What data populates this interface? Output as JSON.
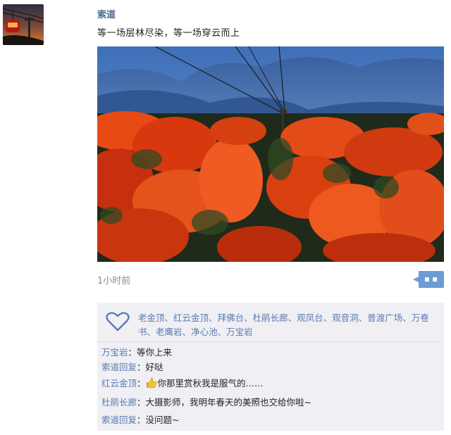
{
  "post": {
    "author": "索道",
    "text": "等一场层林尽染，等一场穿云而上",
    "time": "1小时前"
  },
  "likes": {
    "names": [
      "老金顶",
      "红云金顶",
      "拜佛台",
      "杜鹃长廊",
      "观凤台",
      "观音洞",
      "普渡广场",
      "万卷书",
      "老鹰岩",
      "净心池",
      "万宝岩"
    ]
  },
  "comments": [
    {
      "name": "万宝岩",
      "sep": "：",
      "text": "等你上来"
    },
    {
      "name": "索道回复",
      "sep": "：",
      "text": "好哒"
    },
    {
      "name": "红云金顶",
      "sep": "：",
      "text": "你那里赏秋我是服气的……",
      "icon": "thumbs-up-icon"
    },
    {
      "name": "杜鹃长廊",
      "sep": "：",
      "text": "大摄影师，我明年春天的美照也交给你啦~"
    },
    {
      "name": "索道回复",
      "sep": "：",
      "text": "没问题~"
    }
  ],
  "colors": {
    "link": "#5b7bb0",
    "author": "#4d6a95",
    "panel_bg": "#f0f0f4",
    "accent": "#6d9bd6"
  }
}
